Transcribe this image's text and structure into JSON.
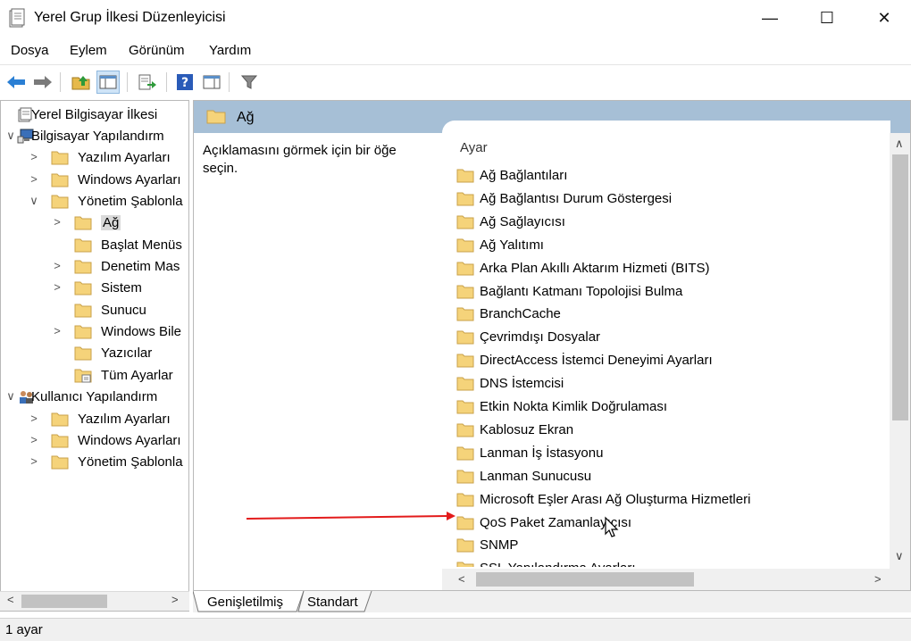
{
  "window": {
    "title": "Yerel Grup İlkesi Düzenleyicisi",
    "minimize_glyph": "—",
    "maximize_glyph": "☐",
    "close_glyph": "✕"
  },
  "menu": [
    "Dosya",
    "Eylem",
    "Görünüm",
    "Yardım"
  ],
  "toolbar": {
    "icons": [
      "back-arrow-icon",
      "forward-arrow-icon",
      "up-folder-icon",
      "show-hide-tree-icon",
      "export-list-icon",
      "help-icon",
      "show-hide-action-pane-icon",
      "filter-icon"
    ]
  },
  "tree": {
    "items": [
      {
        "label": "Yerel Bilgisayar İlkesi",
        "icon": "policy-doc-icon",
        "level": 0,
        "arrow": ""
      },
      {
        "label": "Bilgisayar Yapılandırm",
        "icon": "computer-icon",
        "level": 0,
        "arrow": "∨"
      },
      {
        "label": "Yazılım Ayarları",
        "icon": "folder-icon",
        "level": 1,
        "arrow": ">"
      },
      {
        "label": "Windows Ayarları",
        "icon": "folder-icon",
        "level": 1,
        "arrow": ">"
      },
      {
        "label": "Yönetim Şablonla",
        "icon": "folder-icon",
        "level": 1,
        "arrow": "∨"
      },
      {
        "label": "Ağ",
        "icon": "folder-open-icon",
        "level": 2,
        "arrow": ">",
        "selected": true
      },
      {
        "label": "Başlat Menüs",
        "icon": "folder-icon",
        "level": 2,
        "arrow": ""
      },
      {
        "label": "Denetim Mas",
        "icon": "folder-icon",
        "level": 2,
        "arrow": ">"
      },
      {
        "label": "Sistem",
        "icon": "folder-icon",
        "level": 2,
        "arrow": ">"
      },
      {
        "label": "Sunucu",
        "icon": "folder-icon",
        "level": 2,
        "arrow": ""
      },
      {
        "label": "Windows Bile",
        "icon": "folder-icon",
        "level": 2,
        "arrow": ">"
      },
      {
        "label": "Yazıcılar",
        "icon": "folder-icon",
        "level": 2,
        "arrow": ""
      },
      {
        "label": "Tüm Ayarlar",
        "icon": "all-settings-icon",
        "level": 2,
        "arrow": ""
      },
      {
        "label": "Kullanıcı Yapılandırm",
        "icon": "users-icon",
        "level": 0,
        "arrow": "∨"
      },
      {
        "label": "Yazılım Ayarları",
        "icon": "folder-icon",
        "level": 1,
        "arrow": ">"
      },
      {
        "label": "Windows Ayarları",
        "icon": "folder-icon",
        "level": 1,
        "arrow": ">"
      },
      {
        "label": "Yönetim Şablonla",
        "icon": "folder-icon",
        "level": 1,
        "arrow": ">"
      }
    ]
  },
  "content": {
    "header_title": "Ağ",
    "description": "Açıklamasını görmek için bir öğe seçin.",
    "column_header": "Ayar",
    "items": [
      "Ağ Bağlantıları",
      "Ağ Bağlantısı Durum Göstergesi",
      "Ağ Sağlayıcısı",
      "Ağ Yalıtımı",
      "Arka Plan Akıllı Aktarım Hizmeti (BITS)",
      "Bağlantı Katmanı Topolojisi Bulma",
      "BranchCache",
      "Çevrimdışı Dosyalar",
      "DirectAccess İstemci Deneyimi Ayarları",
      "DNS İstemcisi",
      "Etkin Nokta Kimlik Doğrulaması",
      "Kablosuz Ekran",
      "Lanman İş İstasyonu",
      "Lanman Sunucusu",
      "Microsoft Eşler Arası Ağ Oluşturma Hizmetleri",
      "QoS Paket Zamanlayıcısı",
      "SNMP",
      "SSL Yapılandırma Ayarları"
    ]
  },
  "tabs": [
    "Genişletilmiş",
    "Standart"
  ],
  "status": "1 ayar",
  "colors": {
    "header_blue": "#a6bfd6",
    "folder_yellow": "#f5d37a",
    "annotation_red": "#e31b1b"
  }
}
